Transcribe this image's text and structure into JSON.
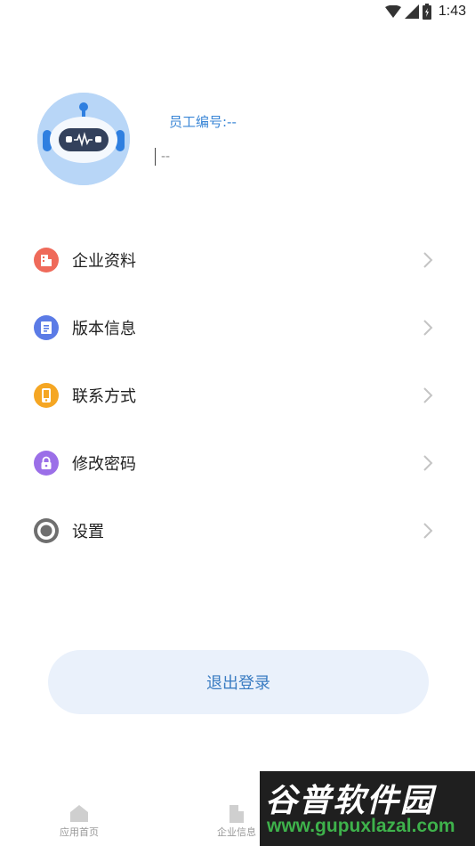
{
  "status_bar": {
    "time": "1:43"
  },
  "profile": {
    "employee_label": "员工编号:--",
    "name_value": "--"
  },
  "menu": {
    "items": [
      {
        "label": "企业资料",
        "icon": "building-icon",
        "color": "#ef6a5a"
      },
      {
        "label": "版本信息",
        "icon": "document-icon",
        "color": "#5b7be6"
      },
      {
        "label": "联系方式",
        "icon": "phone-icon",
        "color": "#f5a623"
      },
      {
        "label": "修改密码",
        "icon": "lock-icon",
        "color": "#9b6fe8"
      },
      {
        "label": "设置",
        "icon": "gear-icon",
        "color": "#6f6f6f"
      }
    ]
  },
  "logout": {
    "label": "退出登录"
  },
  "bottom_nav": {
    "items": [
      {
        "label": "应用首页",
        "icon": "home-icon"
      },
      {
        "label": "企业信息",
        "icon": "building-icon"
      },
      {
        "label": "",
        "icon": "user-icon"
      }
    ]
  },
  "watermark": {
    "title": "谷普软件园",
    "url": "www.gupuxlazal.com"
  },
  "colors": {
    "accent": "#3a86d6",
    "logout_bg": "#eaf1fb",
    "avatar_bg": "#b8d6f7"
  }
}
